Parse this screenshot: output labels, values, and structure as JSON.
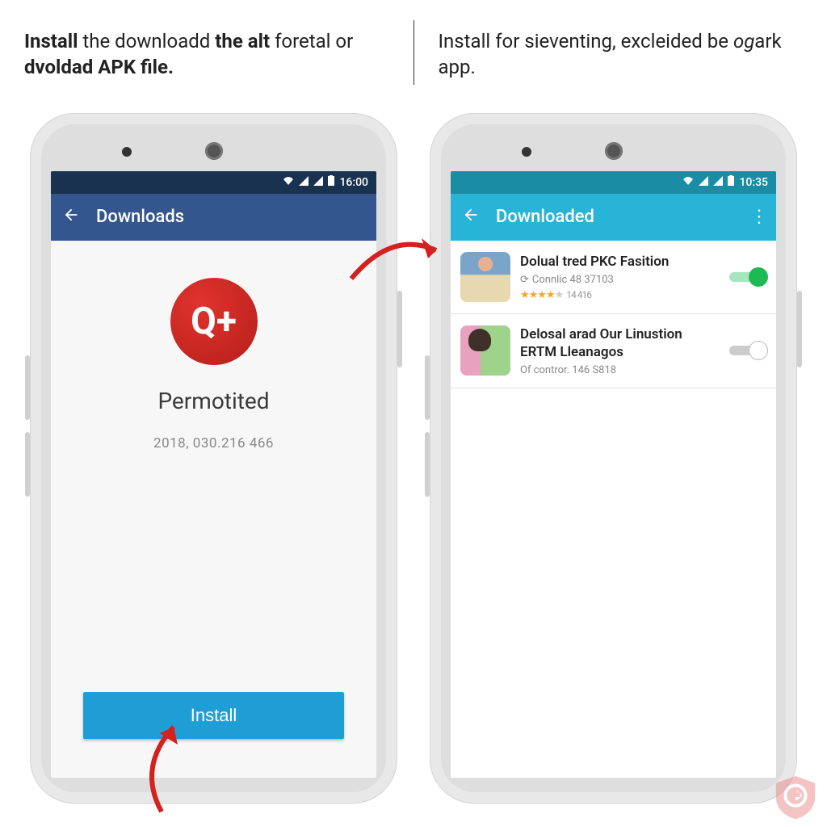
{
  "captions": {
    "left_html": "<b>Install</b> the downloadd <b>the alt</b> foretal or <b>dvoldad APK file.</b>",
    "right_html": "Install for sieventing, excleided be <i>og</i>ark app."
  },
  "left": {
    "status_time": "16:00",
    "appbar_title": "Downloads",
    "app_icon_glyph": "Q+",
    "app_name": "Permotited",
    "version": "2018, 030.216 466",
    "install_label": "Install"
  },
  "right": {
    "status_time": "10:35",
    "appbar_title": "Downloaded",
    "items": [
      {
        "title": "Dolual tred PKC Fasition",
        "sub": "Connlic 48 37103",
        "rating_count": "14 416",
        "toggle_on": true
      },
      {
        "title": "Delosal arad Our Linustion ERTM Lleanagos",
        "sub": "Of contror. 146 S818",
        "rating_count": "",
        "toggle_on": false
      }
    ]
  }
}
